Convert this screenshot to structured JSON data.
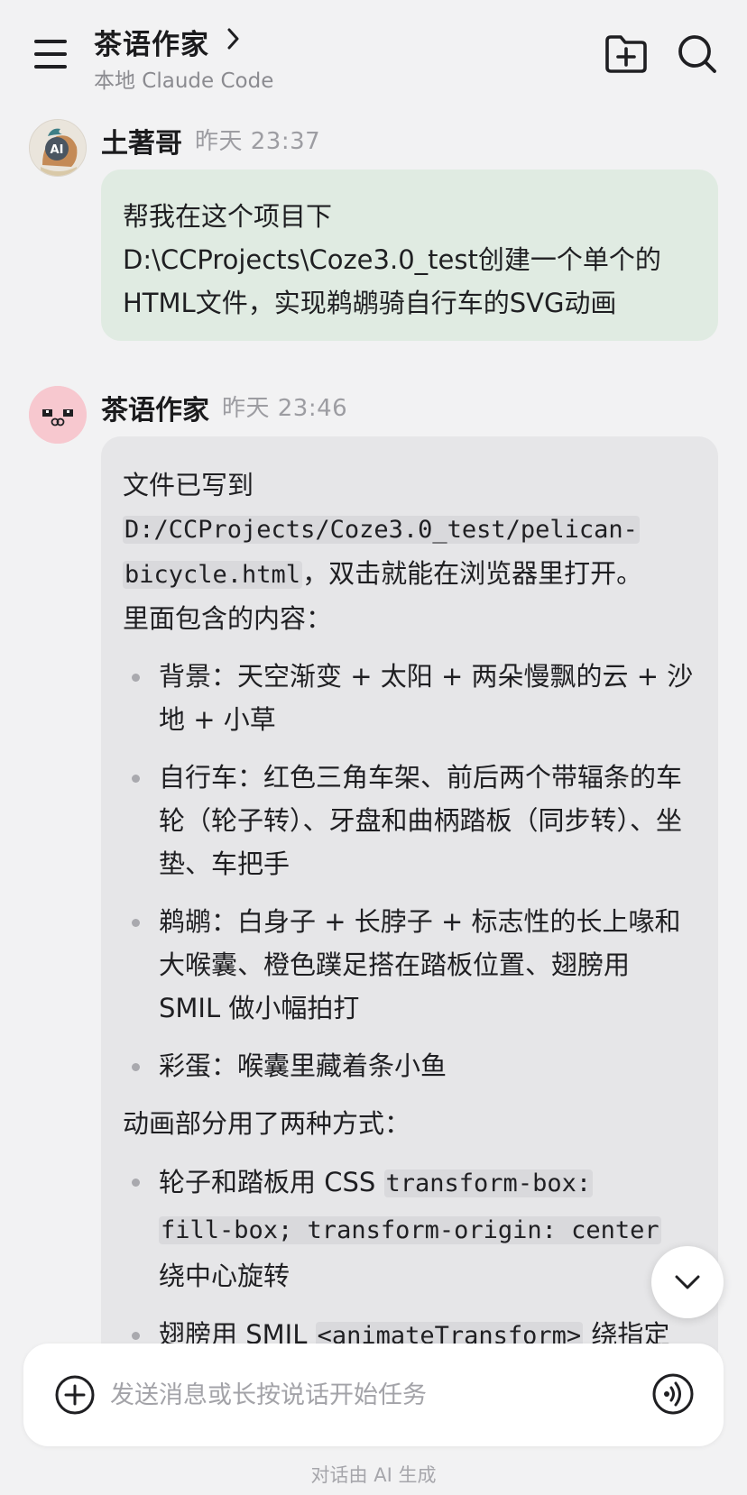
{
  "header": {
    "title": "茶语作家",
    "subtitle": "本地 Claude Code",
    "menu_icon": "menu-icon",
    "folder_icon": "folder-add-icon",
    "search_icon": "search-icon"
  },
  "messages": [
    {
      "sender": "土著哥",
      "time": "昨天  23:37",
      "lines": [
        "帮我在这个项目下",
        "D:\\CCProjects\\Coze3.0_test创建一个单个的",
        "HTML文件，实现鹈鹕骑自行车的SVG动画"
      ]
    },
    {
      "sender": "茶语作家",
      "time": "昨天  23:46",
      "intro_text": "文件已写到",
      "file_path_1": "D:/CCProjects/Coze3.0_test/pelican-",
      "file_path_2": "bicycle.html",
      "after_path": "，双击就能在浏览器里打开。",
      "contents_heading": "里面包含的内容：",
      "items": [
        "背景：天空渐变 + 太阳 + 两朵慢飘的云 + 沙地 + 小草",
        "自行车：红色三角车架、前后两个带辐条的车轮（轮子转）、牙盘和曲柄踏板（同步转）、坐垫、车把手",
        "鹈鹕：白身子 + 长脖子 + 标志性的长上喙和大喉囊、橙色蹼足搭在踏板位置、翅膀用 SMIL 做小幅拍打",
        "彩蛋：喉囊里藏着条小鱼"
      ],
      "animation_heading": "动画部分用了两种方式：",
      "anim_item_1_prefix": "轮子和踏板用 CSS ",
      "anim_item_1_code_1": "transform-box:",
      "anim_item_1_code_2": "fill-box; transform-origin: center",
      "anim_item_1_suffix": "绕中心旋转",
      "anim_item_2_prefix": "翅膀用 SMIL ",
      "anim_item_2_code": "<animateTransform>",
      "anim_item_2_suffix": " 绕指定"
    }
  ],
  "input": {
    "placeholder": "发送消息或长按说话开始任务"
  },
  "footer_note": "对话由 AI 生成",
  "colors": {
    "user_bubble": "#e0ebe2",
    "bot_bubble": "#e6e6e8",
    "background": "#f2f2f3"
  }
}
